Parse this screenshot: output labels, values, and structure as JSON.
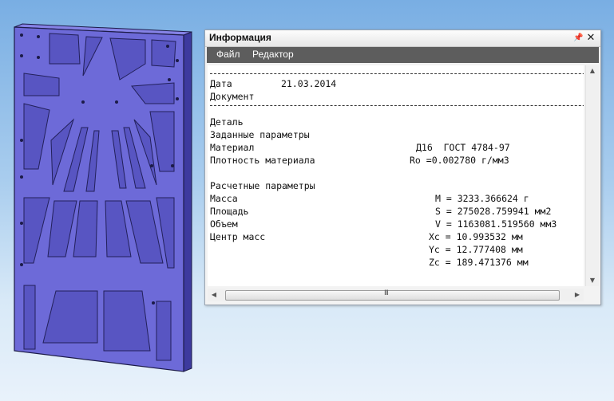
{
  "colors": {
    "model_face": "#6d6ad8",
    "model_side": "#3d3a9e",
    "model_edge": "#1c1b48",
    "menubar_bg": "#5d5d5d"
  },
  "info_panel": {
    "title": "Информация",
    "icons": {
      "pin": "pin-icon",
      "close": "close-icon"
    },
    "menu": [
      "Файл",
      "Редактор"
    ],
    "lines": {
      "date_label": "Дата",
      "date_value": "21.03.2014",
      "document": "Документ",
      "part": "Деталь",
      "given_params": "Заданные параметры",
      "material_label": "Материал",
      "material_value": "Д16  ГОСТ 4784-97",
      "density_label": "Плотность материала",
      "density_value": "Ro =0.002780 г/мм3",
      "calc_params": "Расчетные параметры",
      "mass_label": "Масса",
      "mass_value": "M = 3233.366624 г",
      "area_label": "Площадь",
      "area_value": "S = 275028.759941 мм2",
      "volume_label": "Объем",
      "volume_value": "V = 1163081.519560 мм3",
      "center_label": "Центр масс",
      "xc_value": "Xc = 10.993532 мм",
      "yc_value": "Yc = 12.777408 мм",
      "zc_value": "Zc = 189.471376 мм"
    },
    "scrollbar_grip": "III"
  }
}
